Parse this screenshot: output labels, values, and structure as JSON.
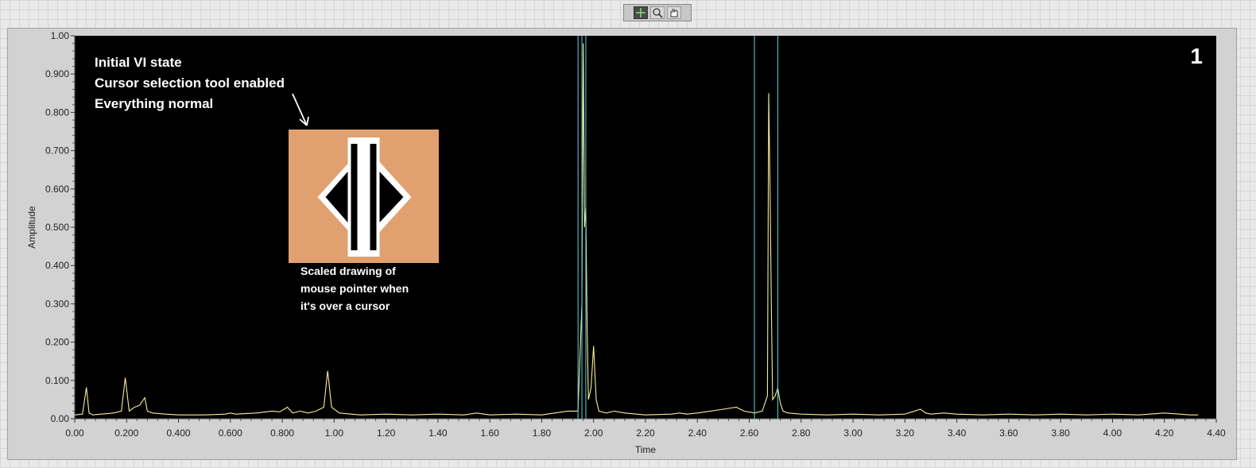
{
  "palette": {
    "tools": [
      {
        "icon": "crosshair-cursor-icon",
        "active": true
      },
      {
        "icon": "zoom-icon",
        "active": false
      },
      {
        "icon": "pan-hand-icon",
        "active": false
      }
    ]
  },
  "graph": {
    "number_label": "1",
    "annotation_lines": [
      "Initial VI state",
      "Cursor selection tool enabled",
      "Everything normal"
    ],
    "pointer_caption_lines": [
      "Scaled drawing of",
      "mouse pointer when",
      "it's over a cursor"
    ],
    "colors": {
      "plot_bg": "#000000",
      "trace": "#f5ee96",
      "cursor": "#59d4e6",
      "icon_bg": "#e1a06f"
    }
  },
  "chart_data": {
    "type": "line",
    "xlabel": "Time",
    "ylabel": "Amplitude",
    "xlim": [
      0,
      4.4
    ],
    "ylim": [
      0,
      1.0
    ],
    "x_ticks": [
      "0.00",
      "0.200",
      "0.400",
      "0.600",
      "0.800",
      "1.00",
      "1.20",
      "1.40",
      "1.60",
      "1.80",
      "2.00",
      "2.20",
      "2.40",
      "2.60",
      "2.80",
      "3.00",
      "3.20",
      "3.40",
      "3.60",
      "3.80",
      "4.00",
      "4.20",
      "4.40"
    ],
    "y_ticks": [
      "0.00",
      "0.100",
      "0.200",
      "0.300",
      "0.400",
      "0.500",
      "0.600",
      "0.700",
      "0.800",
      "0.900",
      "1.00"
    ],
    "grid": false,
    "cursors_x": [
      1.94,
      1.955,
      1.97,
      2.62,
      2.71
    ],
    "series": [
      {
        "x": [
          0.0,
          0.03,
          0.045,
          0.055,
          0.07,
          0.1,
          0.15,
          0.18,
          0.195,
          0.21,
          0.23,
          0.25,
          0.27,
          0.28,
          0.3,
          0.35,
          0.4,
          0.5,
          0.58,
          0.6,
          0.62,
          0.7,
          0.76,
          0.79,
          0.82,
          0.84,
          0.87,
          0.9,
          0.93,
          0.96,
          0.975,
          0.99,
          1.02,
          1.1,
          1.2,
          1.3,
          1.4,
          1.5,
          1.55,
          1.6,
          1.7,
          1.8,
          1.85,
          1.9,
          1.94,
          1.955,
          1.96,
          1.965,
          1.97,
          1.975,
          1.98,
          1.99,
          2.0,
          2.01,
          2.02,
          2.05,
          2.08,
          2.12,
          2.2,
          2.3,
          2.33,
          2.36,
          2.4,
          2.45,
          2.5,
          2.55,
          2.58,
          2.62,
          2.65,
          2.67,
          2.675,
          2.68,
          2.685,
          2.69,
          2.7,
          2.71,
          2.72,
          2.73,
          2.75,
          2.8,
          2.9,
          3.0,
          3.1,
          3.2,
          3.26,
          3.28,
          3.3,
          3.35,
          3.4,
          3.5,
          3.6,
          3.7,
          3.8,
          3.9,
          4.0,
          4.1,
          4.2,
          4.3,
          4.33
        ],
        "values": [
          0.01,
          0.012,
          0.082,
          0.015,
          0.01,
          0.012,
          0.015,
          0.02,
          0.107,
          0.02,
          0.03,
          0.035,
          0.055,
          0.02,
          0.015,
          0.012,
          0.01,
          0.01,
          0.012,
          0.015,
          0.012,
          0.015,
          0.02,
          0.018,
          0.03,
          0.015,
          0.02,
          0.015,
          0.02,
          0.03,
          0.125,
          0.03,
          0.015,
          0.01,
          0.012,
          0.01,
          0.012,
          0.01,
          0.015,
          0.01,
          0.012,
          0.01,
          0.015,
          0.02,
          0.02,
          0.3,
          0.98,
          0.5,
          0.55,
          0.24,
          0.05,
          0.08,
          0.19,
          0.05,
          0.02,
          0.015,
          0.02,
          0.015,
          0.01,
          0.012,
          0.015,
          0.012,
          0.015,
          0.02,
          0.025,
          0.03,
          0.02,
          0.015,
          0.02,
          0.06,
          0.85,
          0.6,
          0.3,
          0.05,
          0.06,
          0.08,
          0.04,
          0.02,
          0.015,
          0.012,
          0.01,
          0.012,
          0.01,
          0.012,
          0.025,
          0.015,
          0.012,
          0.015,
          0.012,
          0.01,
          0.012,
          0.01,
          0.012,
          0.01,
          0.012,
          0.01,
          0.015,
          0.01,
          0.01
        ]
      }
    ]
  }
}
